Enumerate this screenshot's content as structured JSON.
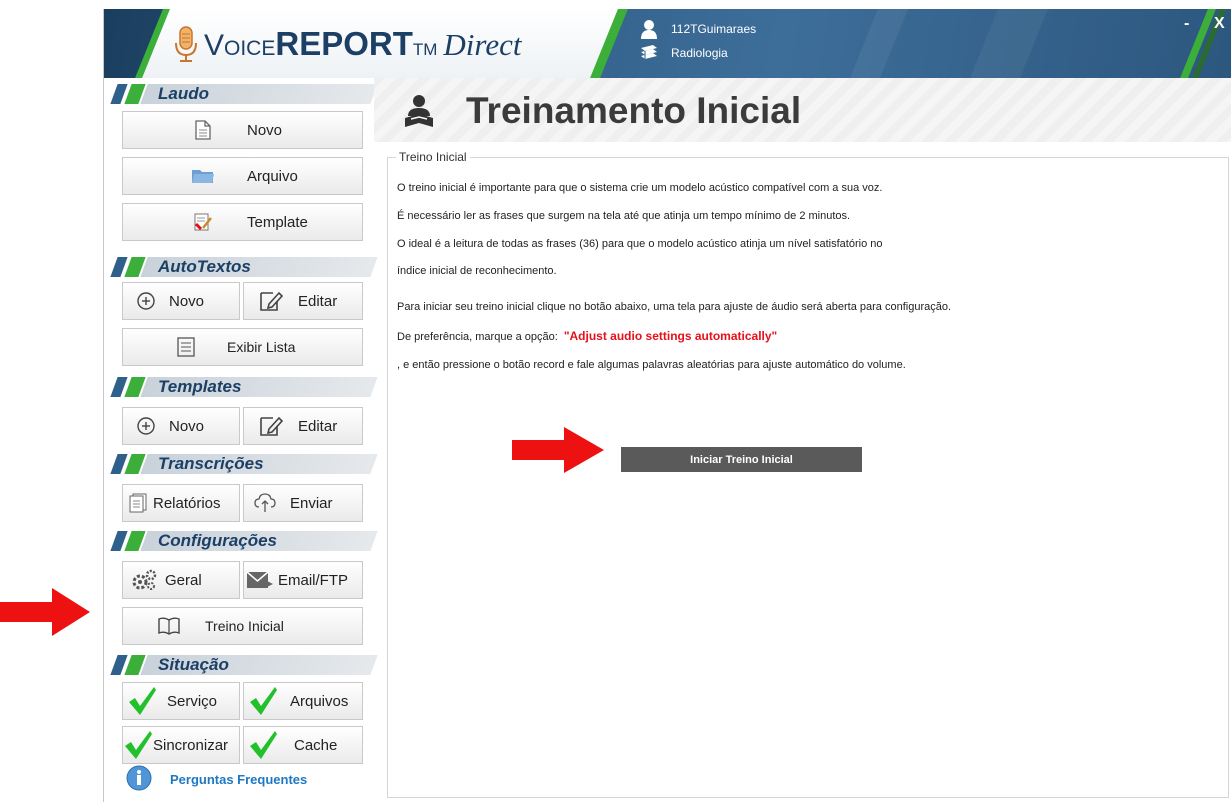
{
  "app": {
    "brand_voice": "Voice",
    "brand_report": "REPORT",
    "brand_tm": "TM",
    "brand_direct": "Direct",
    "user": "112TGuimaraes",
    "department": "Radiologia",
    "minimize": "-",
    "close": "X"
  },
  "sidebar": {
    "laudo": {
      "title": "Laudo",
      "novo": "Novo",
      "arquivo": "Arquivo",
      "template": "Template"
    },
    "autotextos": {
      "title": "AutoTextos",
      "novo": "Novo",
      "editar": "Editar",
      "exibir_lista": "Exibir Lista"
    },
    "templates": {
      "title": "Templates",
      "novo": "Novo",
      "editar": "Editar"
    },
    "transcricoes": {
      "title": "Transcrições",
      "relatorios": "Relatórios",
      "enviar": "Enviar"
    },
    "configuracoes": {
      "title": "Configurações",
      "geral": "Geral",
      "email_ftp": "Email/FTP",
      "treino_inicial": "Treino Inicial"
    },
    "situacao": {
      "title": "Situação",
      "servico": "Serviço",
      "arquivos": "Arquivos",
      "sincronizar": "Sincronizar",
      "cache": "Cache"
    },
    "faq": "Perguntas Frequentes"
  },
  "main": {
    "title": "Treinamento Inicial",
    "group_title": "Treino Inicial",
    "lines": [
      "O treino inicial é importante para que o sistema crie um modelo  acústico compatível com a sua voz.",
      "É necessário ler as frases que surgem na tela até que atinja um tempo mínimo de 2 minutos.",
      "O ideal é a leitura de todas as frases (36) para que o modelo acústico atinja um nível satisfatório no",
      "índice inicial de reconhecimento.",
      "Para iniciar seu treino inicial clique no botão abaixo, uma tela para ajuste de áudio será aberta para configuração.",
      "De preferência, marque a opção:",
      ", e então pressione o botão record e fale algumas palavras aleatórias para ajuste automático do volume."
    ],
    "highlight": "\"Adjust audio settings automatically\"",
    "start_button": "Iniciar Treino Inicial"
  },
  "colors": {
    "accent_red": "#e8101a",
    "brand_blue": "#1c3f66",
    "brand_green": "#3cae3a",
    "button_gray": "#5a5a5a"
  },
  "icons": [
    "microphone-icon",
    "user-icon",
    "book-stack-icon",
    "document-icon",
    "folder-icon",
    "template-icon",
    "plus-circle-icon",
    "edit-icon",
    "list-icon",
    "reports-icon",
    "cloud-upload-icon",
    "gears-icon",
    "email-icon",
    "book-icon",
    "check-icon",
    "info-icon",
    "reader-icon",
    "red-arrow-icon"
  ]
}
